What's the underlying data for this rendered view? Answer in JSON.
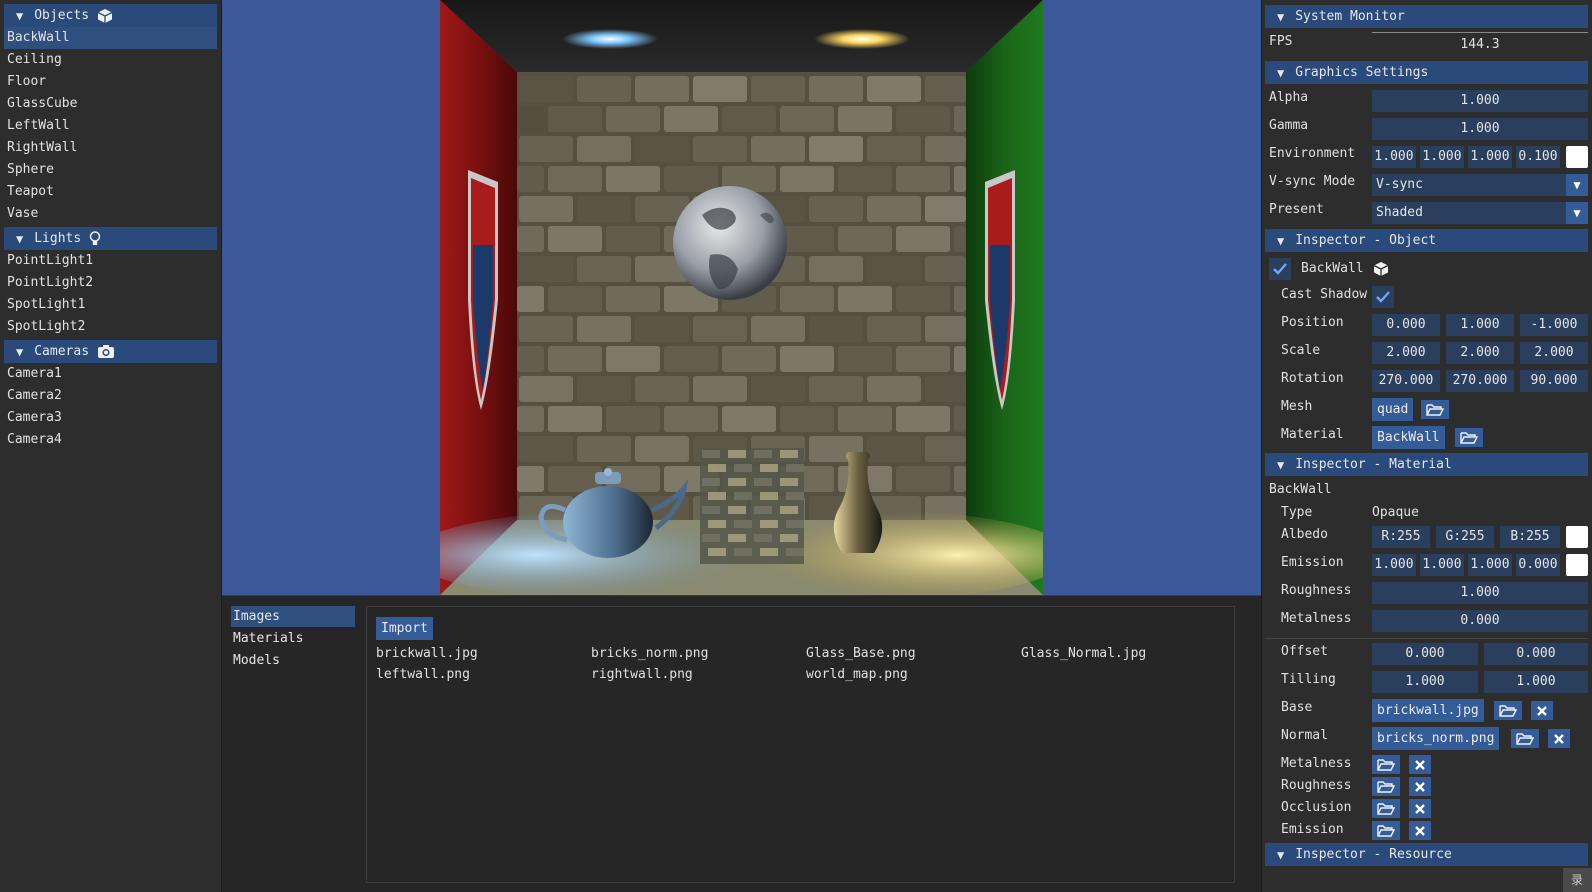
{
  "objects_panel": {
    "title": "Objects",
    "items": [
      "BackWall",
      "Ceiling",
      "Floor",
      "GlassCube",
      "LeftWall",
      "RightWall",
      "Sphere",
      "Teapot",
      "Vase"
    ],
    "selected": "BackWall"
  },
  "lights_panel": {
    "title": "Lights",
    "items": [
      "PointLight1",
      "PointLight2",
      "SpotLight1",
      "SpotLight2"
    ]
  },
  "cameras_panel": {
    "title": "Cameras",
    "items": [
      "Camera1",
      "Camera2",
      "Camera3",
      "Camera4"
    ]
  },
  "assets": {
    "tabs": [
      "Images",
      "Materials",
      "Models"
    ],
    "selected_tab": "Images",
    "import_label": "Import",
    "files": [
      "brickwall.jpg",
      "bricks_norm.png",
      "Glass_Base.png",
      "Glass_Normal.jpg",
      "leftwall.png",
      "rightwall.png",
      "world_map.png"
    ]
  },
  "system_monitor": {
    "title": "System Monitor",
    "fps_label": "FPS",
    "fps_value": "144.3"
  },
  "graphics": {
    "title": "Graphics Settings",
    "alpha_label": "Alpha",
    "alpha": "1.000",
    "gamma_label": "Gamma",
    "gamma": "1.000",
    "environment_label": "Environment",
    "environment": [
      "1.000",
      "1.000",
      "1.000",
      "0.100"
    ],
    "vsync_label": "V-sync Mode",
    "vsync": "V-sync",
    "present_label": "Present",
    "present": "Shaded"
  },
  "inspector_object": {
    "title": "Inspector - Object",
    "name": "BackWall",
    "enabled": true,
    "cast_shadow_label": "Cast Shadow",
    "cast_shadow": true,
    "position_label": "Position",
    "position": [
      "0.000",
      "1.000",
      "-1.000"
    ],
    "scale_label": "Scale",
    "scale": [
      "2.000",
      "2.000",
      "2.000"
    ],
    "rotation_label": "Rotation",
    "rotation": [
      "270.000",
      "270.000",
      "90.000"
    ],
    "mesh_label": "Mesh",
    "mesh": "quad",
    "material_label": "Material",
    "material": "BackWall"
  },
  "inspector_material": {
    "title": "Inspector - Material",
    "name": "BackWall",
    "type_label": "Type",
    "type": "Opaque",
    "albedo_label": "Albedo",
    "albedo": [
      "R:255",
      "G:255",
      "B:255"
    ],
    "emission_label": "Emission",
    "emission": [
      "1.000",
      "1.000",
      "1.000",
      "0.000"
    ],
    "roughness_label": "Roughness",
    "roughness": "1.000",
    "metalness_label": "Metalness",
    "metalness": "0.000",
    "offset_label": "Offset",
    "offset": [
      "0.000",
      "0.000"
    ],
    "tiling_label": "Tilling",
    "tiling": [
      "1.000",
      "1.000"
    ],
    "base_label": "Base",
    "base": "brickwall.jpg",
    "normal_label": "Normal",
    "normal": "bricks_norm.png",
    "tex_metalness_label": "Metalness",
    "tex_roughness_label": "Roughness",
    "tex_occlusion_label": "Occlusion",
    "tex_emission_label": "Emission"
  },
  "inspector_resource": {
    "title": "Inspector - Resource"
  },
  "corner_text": "录",
  "colors": {
    "header": "#294a7a",
    "selection": "#2f4f7f",
    "button": "#345c99",
    "field": "#2a3e5e",
    "viewport_bg": "#3b5998"
  }
}
